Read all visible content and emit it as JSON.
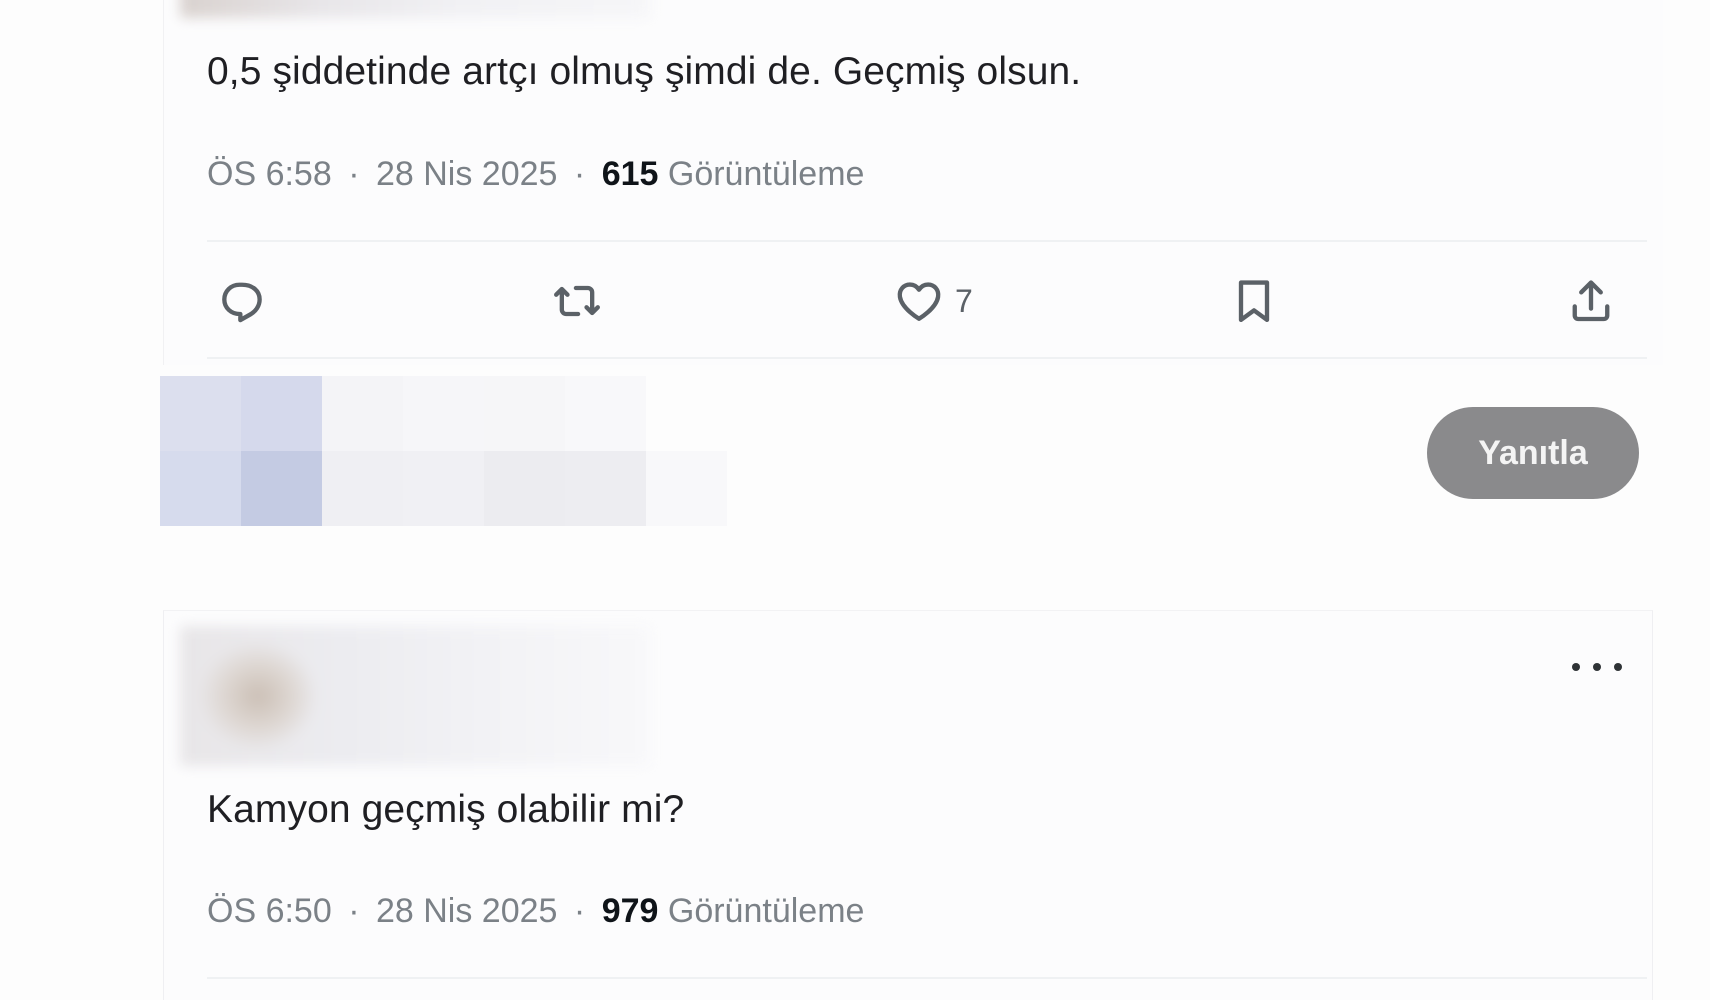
{
  "tweets": [
    {
      "text": "0,5 şiddetinde artçı olmuş şimdi de. Geçmiş olsun.",
      "time": "ÖS 6:58",
      "separator": "·",
      "date": "28 Nis 2025",
      "views_count": "615",
      "views_label": "Görüntüleme",
      "actions": {
        "reply_icon": "reply-icon",
        "retweet_icon": "retweet-icon",
        "like_icon": "heart-icon",
        "like_count": "7",
        "bookmark_icon": "bookmark-icon",
        "share_icon": "share-icon"
      }
    },
    {
      "text": "Kamyon geçmiş olabilir mi?",
      "time": "ÖS 6:50",
      "separator": "·",
      "date": "28 Nis 2025",
      "views_count": "979",
      "views_label": "Görüntüleme",
      "more_icon": "more-horizontal-icon"
    }
  ],
  "composer": {
    "reply_button_label": "Yanıtla",
    "avatar_style": "pixelated"
  },
  "colors": {
    "text_primary": "#0f1419",
    "text_secondary": "#7b8187",
    "icon": "#5b6167",
    "divider": "#eff1f3",
    "reply_button_bg": "#8a8a8c",
    "reply_button_text": "#f4f4f4"
  }
}
